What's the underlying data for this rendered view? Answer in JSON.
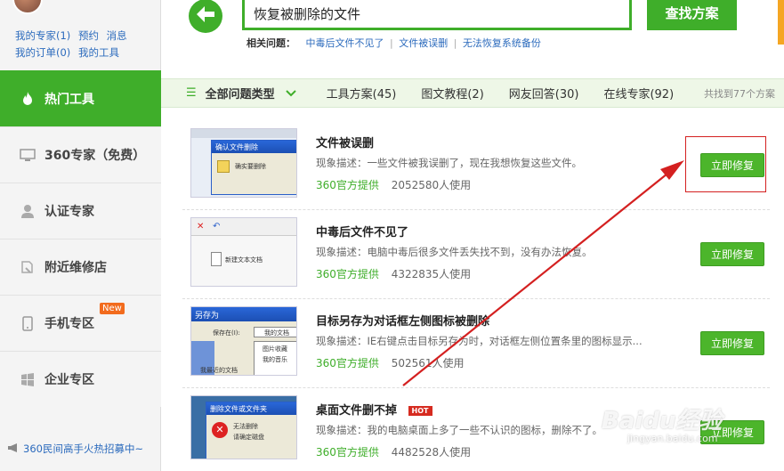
{
  "user": {
    "links_row1": [
      "我的专家(1)",
      "预约",
      "消息"
    ],
    "links_row2": [
      "我的订单(0)",
      "我的工具"
    ]
  },
  "sidebar": {
    "items": [
      {
        "label": "热门工具",
        "icon": "fire-icon"
      },
      {
        "label": "360专家（免费）",
        "icon": "monitor-icon"
      },
      {
        "label": "认证专家",
        "icon": "person-icon"
      },
      {
        "label": "附近维修店",
        "icon": "wrench-icon"
      },
      {
        "label": "手机专区",
        "icon": "phone-icon",
        "badge": "New"
      },
      {
        "label": "企业专区",
        "icon": "windows-icon"
      }
    ],
    "recruit": "360民间高手火热招募中~"
  },
  "search": {
    "value": "恢复被删除的文件",
    "button": "查找方案",
    "related_label": "相关问题：",
    "related": [
      "中毒后文件不见了",
      "文件被误删",
      "无法恢复系统备份"
    ]
  },
  "filter": {
    "all_label": "全部问题类型",
    "tabs": [
      "工具方案(45)",
      "图文教程(2)",
      "网友回答(30)",
      "在线专家(92)"
    ],
    "count": "共找到77个方案"
  },
  "results": [
    {
      "title": "文件被误删",
      "desc": "现象描述：一些文件被我误删了，现在我想恢复这些文件。",
      "provider": "360官方提供",
      "users": "2052580人使用",
      "button": "立即修复",
      "thumb_text": [
        "确认文件删除",
        "确实要删除"
      ]
    },
    {
      "title": "中毒后文件不见了",
      "desc": "现象描述：电脑中毒后很多文件丢失找不到，没有办法恢复。",
      "provider": "360官方提供",
      "users": "4322835人使用",
      "button": "立即修复",
      "thumb_text": [
        "新建文本文档"
      ]
    },
    {
      "title": "目标另存为对话框左侧图标被删除",
      "desc": "现象描述：IE右键点击目标另存为时，对话框左侧位置条里的图标显示...",
      "provider": "360官方提供",
      "users": "502561人使用",
      "button": "立即修复",
      "thumb_text": [
        "另存为",
        "保存在(I):",
        "我的文档",
        "图片收藏",
        "我的音乐",
        "我最近的文档"
      ]
    },
    {
      "title": "桌面文件删不掉",
      "hot": "HOT",
      "desc": "现象描述：我的电脑桌面上多了一些不认识的图标，删除不了。",
      "provider": "360官方提供",
      "users": "4482528人使用",
      "button": "立即修复",
      "thumb_text": [
        "删除文件或文件夹",
        "无法删除",
        "请确定磁盘"
      ]
    }
  ],
  "watermark": {
    "main": "Baidu经验",
    "sub": "jingyan.baidu.com"
  },
  "colors": {
    "accent": "#3fae2a",
    "link": "#2c6bbd",
    "annotation": "#d42020"
  }
}
